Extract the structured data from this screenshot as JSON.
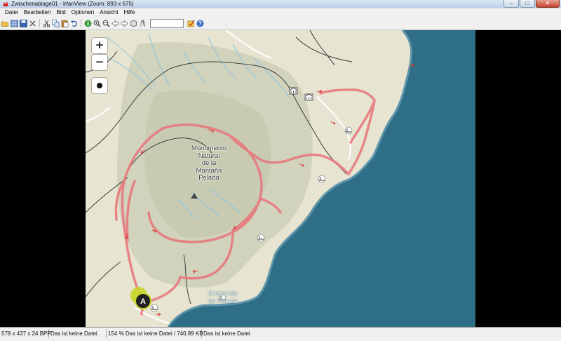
{
  "window": {
    "title": "Zwischenablage01 - IrfanView (Zoom: 893 x 675)",
    "controls": [
      "minimize",
      "maximize",
      "close"
    ]
  },
  "menu": [
    "Datei",
    "Bearbeiten",
    "Bild",
    "Optionen",
    "Ansicht",
    "Hilfe"
  ],
  "toolbar": {
    "icons": [
      "open-folder-icon",
      "thumbnails-icon",
      "save-icon",
      "delete-icon",
      "cut-icon",
      "copy-icon",
      "paste-icon",
      "undo-icon",
      "info-icon",
      "zoom-in-icon",
      "zoom-out-icon",
      "previous-icon",
      "next-icon",
      "slideshow-icon",
      "properties-icon",
      "settings-icon",
      "help-icon"
    ],
    "page_input_value": ""
  },
  "map": {
    "zoom_in": "+",
    "zoom_out": "−",
    "mountain_label": "Monumento\nNatural\nde la\nMontaña\nPelada",
    "bay_label": "Ensenada\nde Pelada",
    "start_marker": "A",
    "colors": {
      "land": "#e7e5d2",
      "mountain": "#cdcfb6",
      "sea": "#2e6e86",
      "route": "#e8757a",
      "stream": "#8cc4df",
      "road": "#3b3b3b",
      "track": "#ffffff"
    }
  },
  "statusbar": {
    "dimensions": "578 x 437 x 24 BPP",
    "file_state": "Das ist keine Datei",
    "zoom_info": "154 % Das ist keine Datei / 740.89 KB",
    "file_state_2": "Das ist keine Datei"
  }
}
